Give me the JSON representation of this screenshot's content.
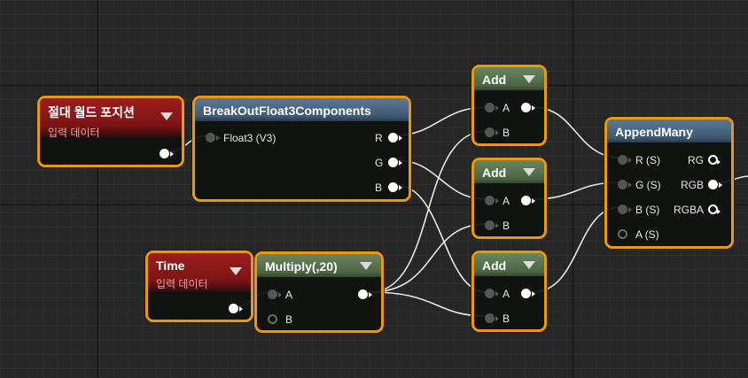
{
  "nodes": {
    "abs_world_pos": {
      "title": "절대 월드 포지션",
      "subtitle": "입력 데이터"
    },
    "breakout": {
      "title": "BreakOutFloat3Components",
      "input": "Float3 (V3)",
      "outputs": [
        "R",
        "G",
        "B"
      ]
    },
    "time": {
      "title": "Time",
      "subtitle": "입력 데이터"
    },
    "multiply": {
      "title": "Multiply(,20)",
      "inputs": [
        "A",
        "B"
      ]
    },
    "add1": {
      "title": "Add",
      "inputs": [
        "A",
        "B"
      ]
    },
    "add2": {
      "title": "Add",
      "inputs": [
        "A",
        "B"
      ]
    },
    "add3": {
      "title": "Add",
      "inputs": [
        "A",
        "B"
      ]
    },
    "append": {
      "title": "AppendMany",
      "inputs": [
        "R (S)",
        "G (S)",
        "B (S)",
        "A (S)"
      ],
      "outputs": [
        "RG",
        "RGB",
        "RGBA"
      ]
    }
  },
  "colors": {
    "selection": "#e79a10",
    "input_header": "#8b1a1a",
    "function_header": "#4a6a87",
    "math_header": "#5a7550",
    "wire": "#e8e8e8"
  },
  "icons": [
    "dropdown-caret-icon",
    "pin-connected-icon",
    "pin-unconnected-icon"
  ]
}
